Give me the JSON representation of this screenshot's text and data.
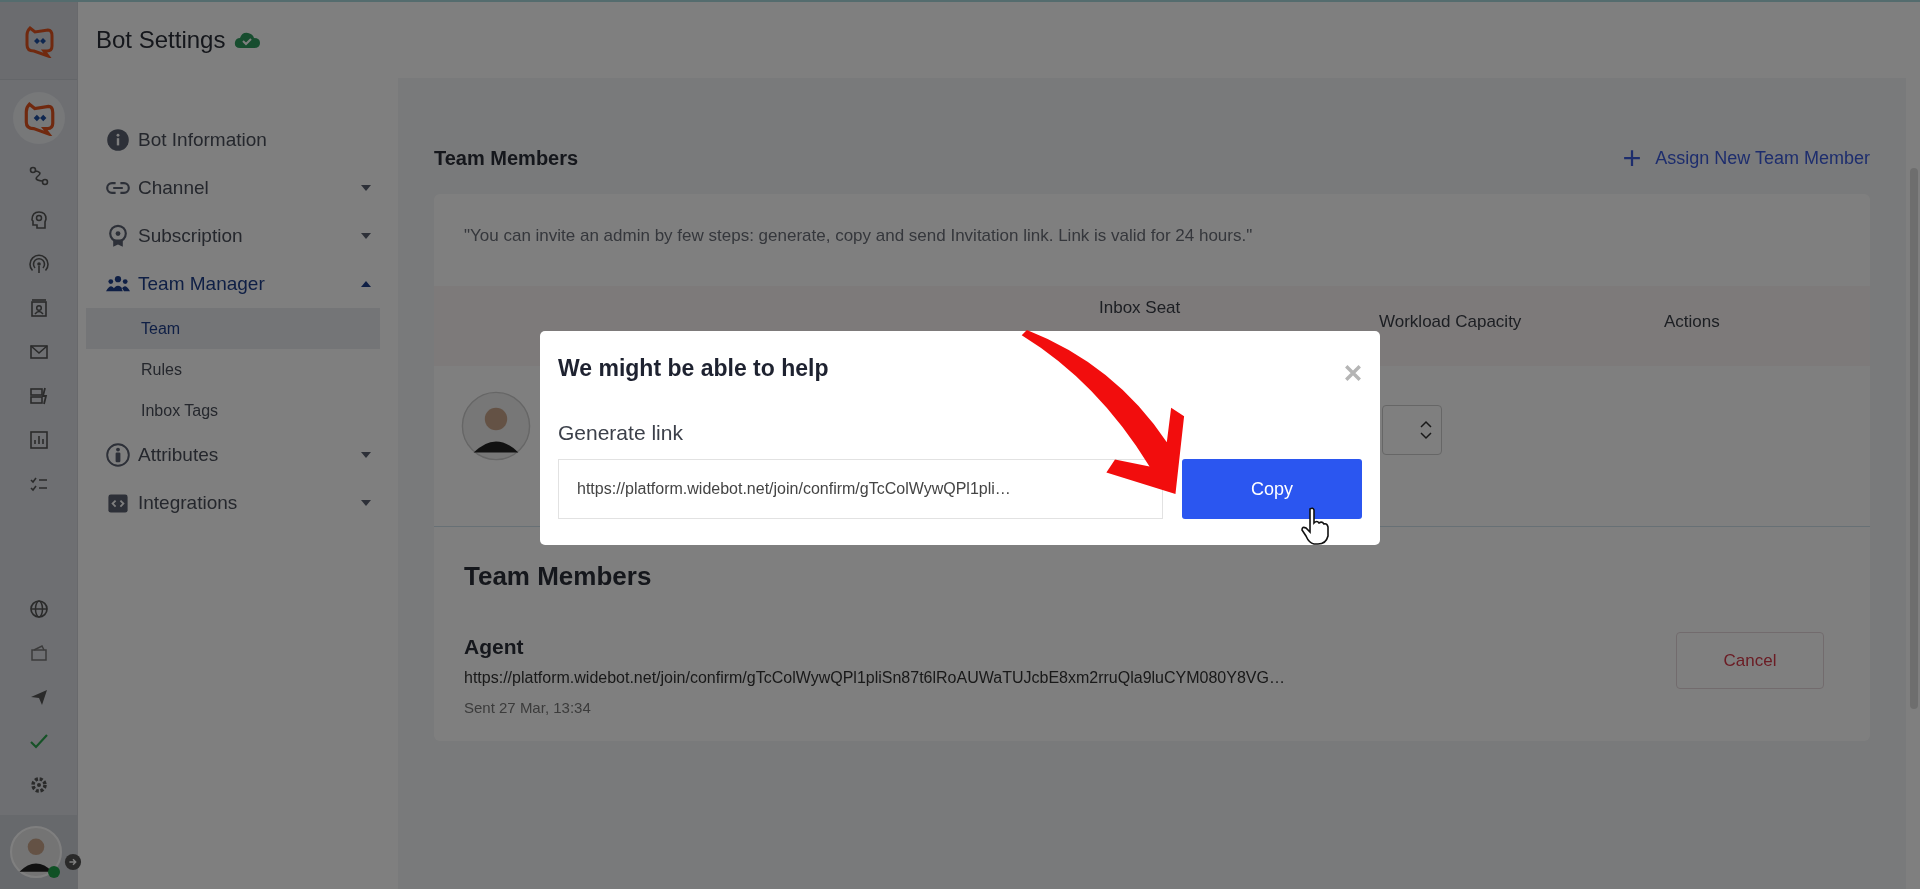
{
  "header": {
    "title": "Bot Settings"
  },
  "sidebar": {
    "items": [
      {
        "label": "Bot Information",
        "kind": "info"
      },
      {
        "label": "Channel",
        "kind": "link",
        "expanded": false
      },
      {
        "label": "Subscription",
        "kind": "badge",
        "expanded": false
      },
      {
        "label": "Team Manager",
        "kind": "team",
        "expanded": true,
        "children": [
          {
            "label": "Team",
            "selected": true
          },
          {
            "label": "Rules",
            "selected": false
          },
          {
            "label": "Inbox Tags",
            "selected": false
          }
        ]
      },
      {
        "label": "Attributes",
        "kind": "person",
        "expanded": false
      },
      {
        "label": "Integrations",
        "kind": "code",
        "expanded": false
      }
    ]
  },
  "main": {
    "title": "Team Members",
    "assign_button": "Assign New Team Member",
    "note": "\"You can invite an admin by few steps: generate, copy and send Invitation link. Link is valid for 24 hours.\"",
    "table": {
      "columns": [
        "Inbox Seat",
        "Workload Capacity",
        "Actions"
      ]
    },
    "invitations": {
      "title": "Team Members",
      "items": [
        {
          "role": "Agent",
          "link": "https://platform.widebot.net/join/confirm/gTcColWywQPl1pliSn87t6lRoAUWaTUJcbE8xm2rruQla9luCYM080Y8VG…",
          "sent": "Sent 27 Mar, 13:34",
          "action": "Cancel"
        }
      ]
    }
  },
  "modal": {
    "title": "We might be able to help",
    "field_label": "Generate link",
    "link_value": "https://platform.widebot.net/join/confirm/gTcColWywQPl1pli…",
    "button": "Copy"
  }
}
